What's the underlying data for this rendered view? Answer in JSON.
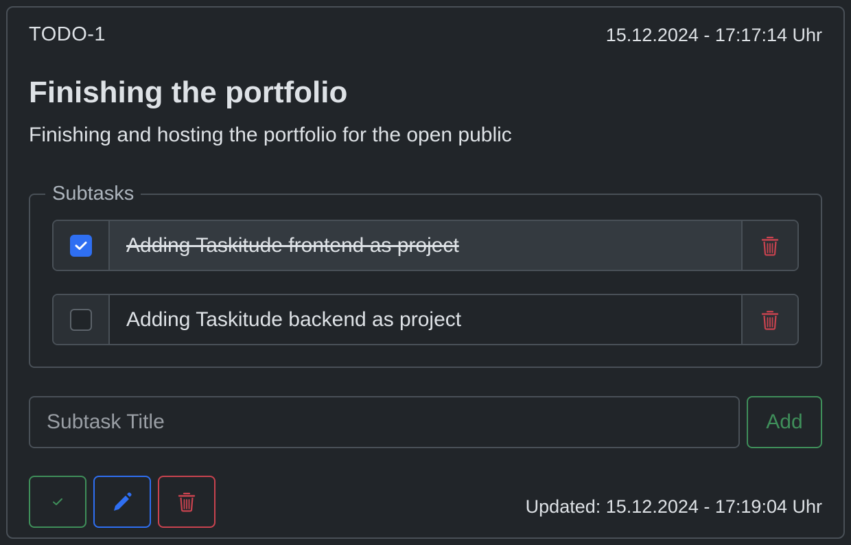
{
  "todo": {
    "id": "TODO-1",
    "created": "15.12.2024 - 17:17:14 Uhr",
    "title": "Finishing the portfolio",
    "description": "Finishing and hosting the portfolio for the open public",
    "updated": "Updated: 15.12.2024 - 17:19:04 Uhr"
  },
  "subtasks": {
    "legend": "Subtasks",
    "items": [
      {
        "label": "Adding Taskitude frontend as project",
        "checked": true,
        "delete_icon": "trash-icon"
      },
      {
        "label": "Adding Taskitude backend as project",
        "checked": false,
        "delete_icon": "trash-icon"
      }
    ]
  },
  "new_subtask": {
    "placeholder": "Subtask Title",
    "value": "",
    "add_label": "Add"
  },
  "actions": {
    "complete_icon": "check-icon",
    "edit_icon": "pencil-icon",
    "delete_icon": "trash-icon"
  },
  "colors": {
    "background": "#212529",
    "border": "#495057",
    "primary": "#2f6ff2",
    "success": "#3f8f5a",
    "danger": "#c9434f"
  }
}
